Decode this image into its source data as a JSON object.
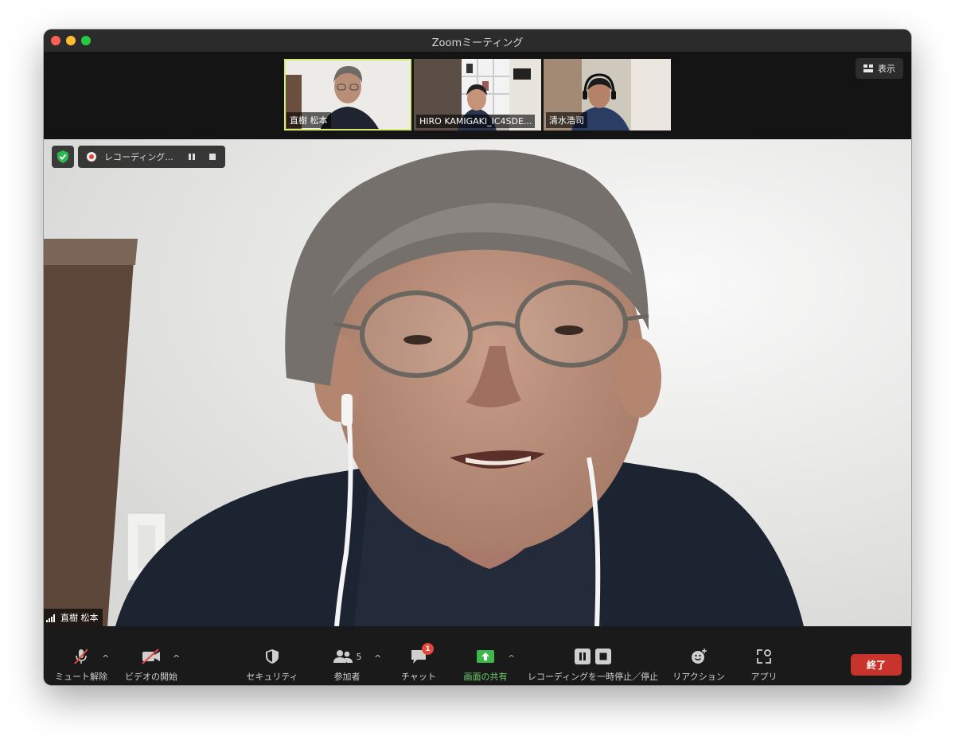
{
  "window": {
    "title": "Zoomミーティング"
  },
  "gallery": {
    "participants": [
      {
        "name": "直樹 松本",
        "active": true
      },
      {
        "name": "HIRO KAMIGAKI_IC4SDE..."
      },
      {
        "name": "清水浩司"
      }
    ],
    "view_button": "表示"
  },
  "main_video": {
    "recording_label": "レコーディング...",
    "speaker_name": "直樹 松本"
  },
  "toolbar": {
    "mute": "ミュート解除",
    "video": "ビデオの開始",
    "security": "セキュリティ",
    "participants": "参加者",
    "participants_count": "5",
    "chat": "チャット",
    "chat_badge": "1",
    "share": "画面の共有",
    "recording": "レコーディングを一時停止／停止",
    "reactions": "リアクション",
    "apps": "アプリ",
    "end": "終了"
  },
  "colors": {
    "active_speaker_border": "#d6ec74",
    "share_green": "#3db84a",
    "end_red": "#c8342b",
    "record_red": "#e0453a"
  }
}
